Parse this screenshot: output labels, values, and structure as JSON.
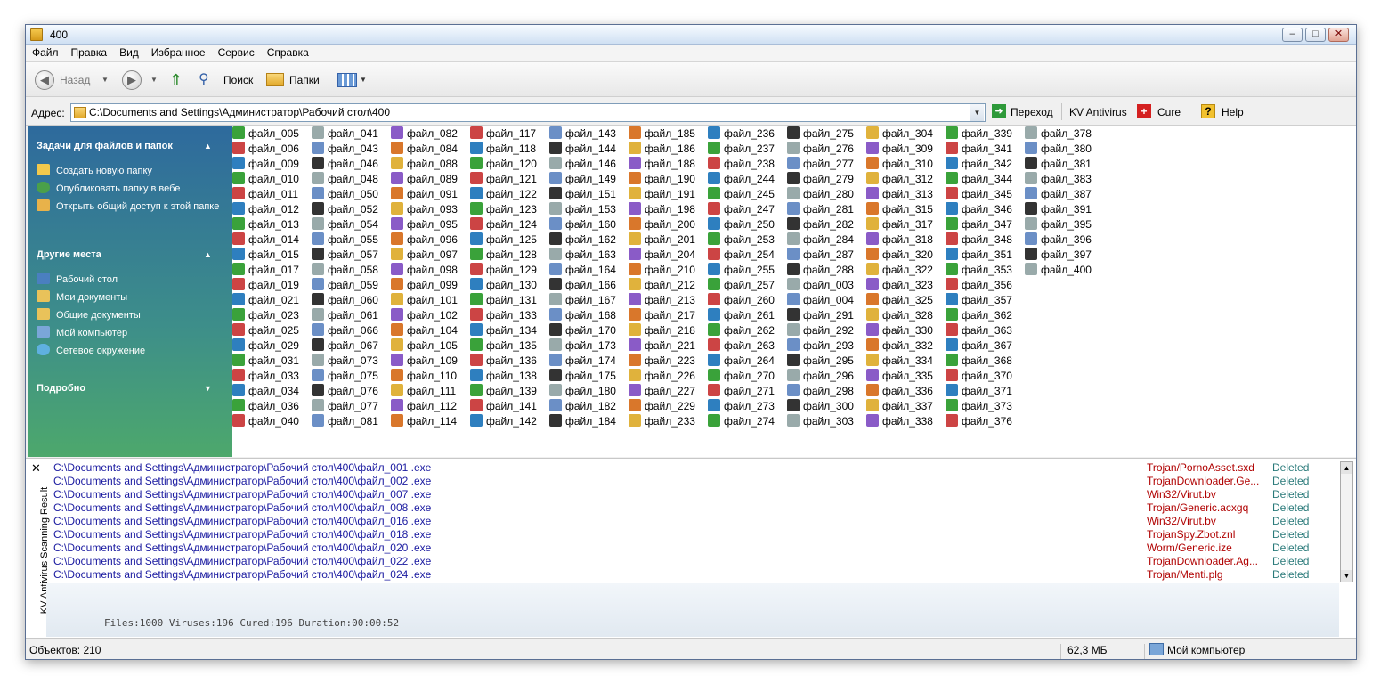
{
  "window": {
    "title": "400"
  },
  "menu": [
    "Файл",
    "Правка",
    "Вид",
    "Избранное",
    "Сервис",
    "Справка"
  ],
  "toolbar": {
    "back": "Назад",
    "search": "Поиск",
    "folders": "Папки"
  },
  "address": {
    "label": "Адрес:",
    "value": "C:\\Documents and Settings\\Администратор\\Рабочий стол\\400",
    "go": "Переход",
    "kv": "KV Antivirus",
    "cure": "Cure",
    "help": "Help"
  },
  "taskpane": {
    "tasks_title": "Задачи для файлов и папок",
    "tasks": [
      "Создать новую папку",
      "Опубликовать папку в вебе",
      "Открыть общий доступ к этой папке"
    ],
    "places_title": "Другие места",
    "places": [
      "Рабочий стол",
      "Мои документы",
      "Общие документы",
      "Мой компьютер",
      "Сетевое окружение"
    ],
    "details_title": "Подробно"
  },
  "files": [
    [
      "файл_005",
      "файл_006",
      "файл_009",
      "файл_010",
      "файл_011",
      "файл_012",
      "файл_013",
      "файл_014",
      "файл_015",
      "файл_017",
      "файл_019",
      "файл_021",
      "файл_023",
      "файл_025",
      "файл_029",
      "файл_031",
      "файл_033",
      "файл_034",
      "файл_036",
      "файл_040"
    ],
    [
      "файл_041",
      "файл_043",
      "файл_046",
      "файл_048",
      "файл_050",
      "файл_052",
      "файл_054",
      "файл_055",
      "файл_057",
      "файл_058",
      "файл_059",
      "файл_060",
      "файл_061",
      "файл_066",
      "файл_067",
      "файл_073",
      "файл_075",
      "файл_076",
      "файл_077",
      "файл_081"
    ],
    [
      "файл_082",
      "файл_084",
      "файл_088",
      "файл_089",
      "файл_091",
      "файл_093",
      "файл_095",
      "файл_096",
      "файл_097",
      "файл_098",
      "файл_099",
      "файл_101",
      "файл_102",
      "файл_104",
      "файл_105",
      "файл_109",
      "файл_110",
      "файл_111",
      "файл_112",
      "файл_114"
    ],
    [
      "файл_117",
      "файл_118",
      "файл_120",
      "файл_121",
      "файл_122",
      "файл_123",
      "файл_124",
      "файл_125",
      "файл_128",
      "файл_129",
      "файл_130",
      "файл_131",
      "файл_133",
      "файл_134",
      "файл_135",
      "файл_136",
      "файл_138",
      "файл_139",
      "файл_141",
      "файл_142"
    ],
    [
      "файл_143",
      "файл_144",
      "файл_146",
      "файл_149",
      "файл_151",
      "файл_153",
      "файл_160",
      "файл_162",
      "файл_163",
      "файл_164",
      "файл_166",
      "файл_167",
      "файл_168",
      "файл_170",
      "файл_173",
      "файл_174",
      "файл_175",
      "файл_180",
      "файл_182",
      "файл_184"
    ],
    [
      "файл_185",
      "файл_186",
      "файл_188",
      "файл_190",
      "файл_191",
      "файл_198",
      "файл_200",
      "файл_201",
      "файл_204",
      "файл_210",
      "файл_212",
      "файл_213",
      "файл_217",
      "файл_218",
      "файл_221",
      "файл_223",
      "файл_226",
      "файл_227",
      "файл_229",
      "файл_233"
    ],
    [
      "файл_236",
      "файл_237",
      "файл_238",
      "файл_244",
      "файл_245",
      "файл_247",
      "файл_250",
      "файл_253",
      "файл_254",
      "файл_255",
      "файл_257",
      "файл_260",
      "файл_261",
      "файл_262",
      "файл_263",
      "файл_264",
      "файл_270",
      "файл_271",
      "файл_273",
      "файл_274"
    ],
    [
      "файл_275",
      "файл_276",
      "файл_277",
      "файл_279",
      "файл_280",
      "файл_281",
      "файл_282",
      "файл_284",
      "файл_287",
      "файл_288",
      "файл_003",
      "файл_004",
      "файл_291",
      "файл_292",
      "файл_293",
      "файл_295",
      "файл_296",
      "файл_298",
      "файл_300",
      "файл_303"
    ],
    [
      "файл_304",
      "файл_309",
      "файл_310",
      "файл_312",
      "файл_313",
      "файл_315",
      "файл_317",
      "файл_318",
      "файл_320",
      "файл_322",
      "файл_323",
      "файл_325",
      "файл_328",
      "файл_330",
      "файл_332",
      "файл_334",
      "файл_335",
      "файл_336",
      "файл_337",
      "файл_338"
    ],
    [
      "файл_339",
      "файл_341",
      "файл_342",
      "файл_344",
      "файл_345",
      "файл_346",
      "файл_347",
      "файл_348",
      "файл_351",
      "файл_353",
      "файл_356",
      "файл_357",
      "файл_362",
      "файл_363",
      "файл_367",
      "файл_368",
      "файл_370",
      "файл_371",
      "файл_373",
      "файл_376"
    ],
    [
      "файл_378",
      "файл_380",
      "файл_381",
      "файл_383",
      "файл_387",
      "файл_391",
      "файл_395",
      "файл_396",
      "файл_397",
      "файл_400"
    ]
  ],
  "scan": {
    "title": "KV Antivirus Scanning Result",
    "rows": [
      {
        "path": "C:\\Documents and Settings\\Администратор\\Рабочий стол\\400\\файл_001 .exe",
        "virus": "Trojan/PornoAsset.sxd",
        "status": "Deleted"
      },
      {
        "path": "C:\\Documents and Settings\\Администратор\\Рабочий стол\\400\\файл_002 .exe",
        "virus": "TrojanDownloader.Ge...",
        "status": "Deleted"
      },
      {
        "path": "C:\\Documents and Settings\\Администратор\\Рабочий стол\\400\\файл_007 .exe",
        "virus": "Win32/Virut.bv",
        "status": "Deleted"
      },
      {
        "path": "C:\\Documents and Settings\\Администратор\\Рабочий стол\\400\\файл_008 .exe",
        "virus": "Trojan/Generic.acxgq",
        "status": "Deleted"
      },
      {
        "path": "C:\\Documents and Settings\\Администратор\\Рабочий стол\\400\\файл_016 .exe",
        "virus": "Win32/Virut.bv",
        "status": "Deleted"
      },
      {
        "path": "C:\\Documents and Settings\\Администратор\\Рабочий стол\\400\\файл_018 .exe",
        "virus": "TrojanSpy.Zbot.znl",
        "status": "Deleted"
      },
      {
        "path": "C:\\Documents and Settings\\Администратор\\Рабочий стол\\400\\файл_020 .exe",
        "virus": "Worm/Generic.ize",
        "status": "Deleted"
      },
      {
        "path": "C:\\Documents and Settings\\Администратор\\Рабочий стол\\400\\файл_022 .exe",
        "virus": "TrojanDownloader.Ag...",
        "status": "Deleted"
      },
      {
        "path": "C:\\Documents and Settings\\Администратор\\Рабочий стол\\400\\файл_024 .exe",
        "virus": "Trojan/Menti.plg",
        "status": "Deleted"
      }
    ],
    "summary": "Files:1000 Viruses:196 Cured:196 Duration:00:00:52"
  },
  "status": {
    "objects": "Объектов: 210",
    "size": "62,3 МБ",
    "location": "Мой компьютер"
  },
  "colors": {
    "taskpane_top": "#2e6a9d",
    "taskpane_bottom": "#4da86c",
    "virus_text": "#b00000",
    "path_text": "#1a1aa0",
    "status_text": "#2a7a7a"
  }
}
